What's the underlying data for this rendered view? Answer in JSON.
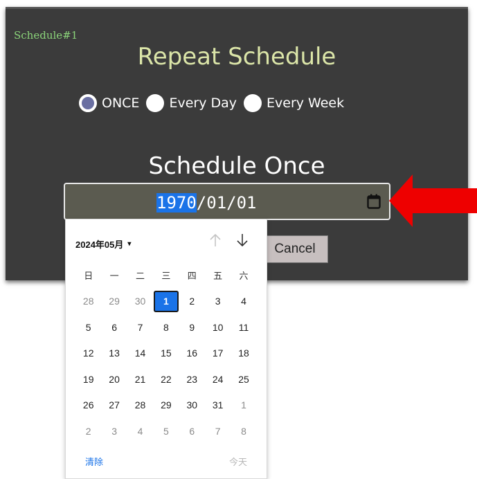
{
  "dialog": {
    "tag": "Schedule#1",
    "title": "Repeat Schedule",
    "radios": [
      {
        "label": "ONCE",
        "checked": true
      },
      {
        "label": "Every Day",
        "checked": false
      },
      {
        "label": "Every Week",
        "checked": false
      }
    ],
    "subtitle": "Schedule Once",
    "date": {
      "year": "1970",
      "rest": "/01/01"
    },
    "cancel_label": "Cancel",
    "icons": {
      "calendar": "calendar-icon",
      "arrow": "red-arrow-pointer"
    }
  },
  "picker": {
    "month_label": "2024年05月",
    "caret": "▾",
    "weekdays": [
      "日",
      "一",
      "二",
      "三",
      "四",
      "五",
      "六"
    ],
    "days": [
      [
        "28",
        "29",
        "30",
        "1",
        "2",
        "3",
        "4"
      ],
      [
        "5",
        "6",
        "7",
        "8",
        "9",
        "10",
        "11"
      ],
      [
        "12",
        "13",
        "14",
        "15",
        "16",
        "17",
        "18"
      ],
      [
        "19",
        "20",
        "21",
        "22",
        "23",
        "24",
        "25"
      ],
      [
        "26",
        "27",
        "28",
        "29",
        "30",
        "31",
        "1"
      ],
      [
        "2",
        "3",
        "4",
        "5",
        "6",
        "7",
        "8"
      ]
    ],
    "muted": [
      [
        true,
        true,
        true,
        false,
        false,
        false,
        false
      ],
      [
        false,
        false,
        false,
        false,
        false,
        false,
        false
      ],
      [
        false,
        false,
        false,
        false,
        false,
        false,
        false
      ],
      [
        false,
        false,
        false,
        false,
        false,
        false,
        false
      ],
      [
        false,
        false,
        false,
        false,
        false,
        false,
        true
      ],
      [
        true,
        true,
        true,
        true,
        true,
        true,
        true
      ]
    ],
    "selected": {
      "row": 0,
      "col": 3
    },
    "clear_label": "清除",
    "today_label": "今天"
  },
  "colors": {
    "dialog_bg": "#3b3b3b",
    "accent_blue": "#1a73e8",
    "tag_green": "#8bd47a",
    "title_yellow": "#dbe5a8",
    "arrow_red": "#ee0000"
  }
}
